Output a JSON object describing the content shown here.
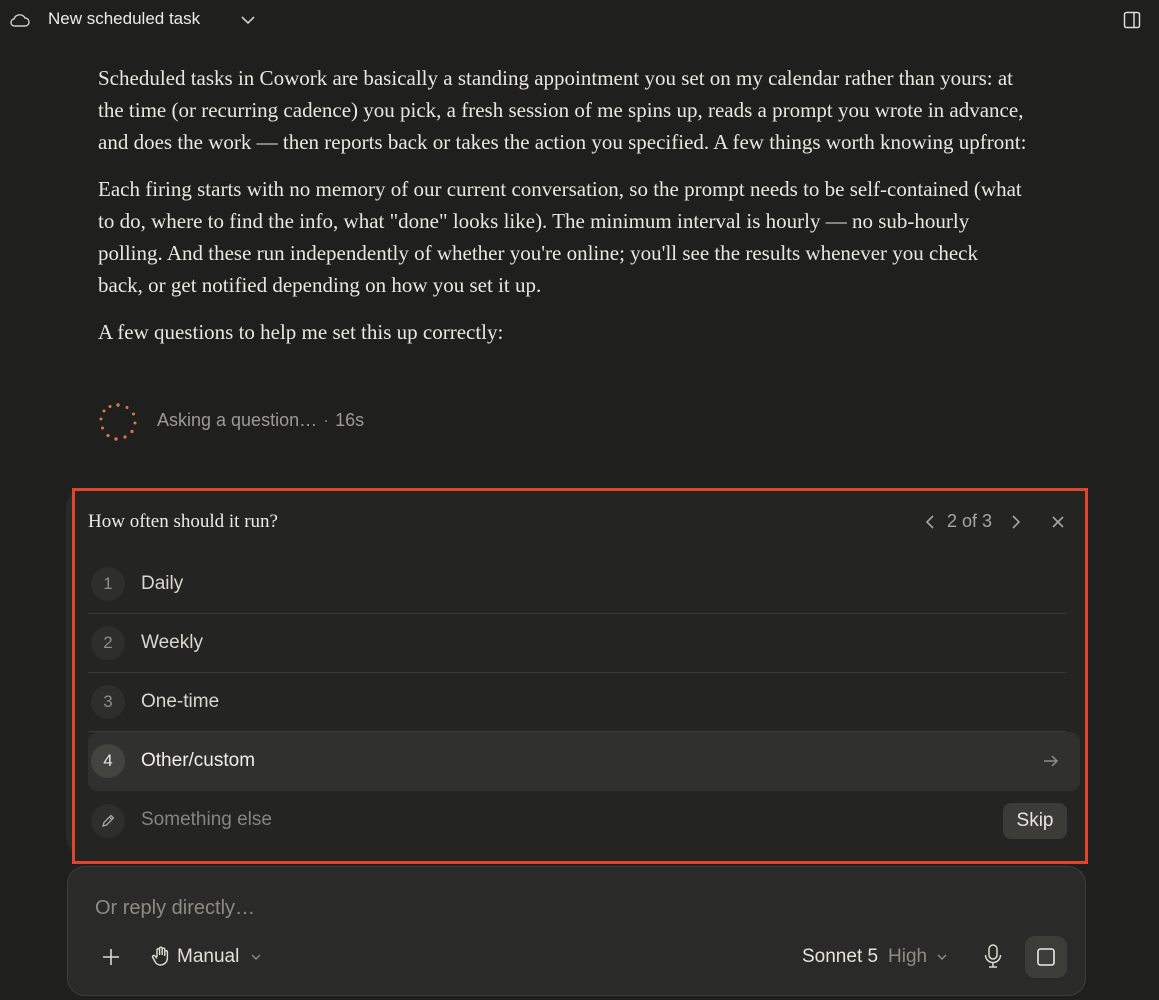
{
  "header": {
    "title": "New scheduled task"
  },
  "message": {
    "paragraphs": [
      "Scheduled tasks in Cowork are basically a standing appointment you set on my calendar rather than yours: at the time (or recurring cadence) you pick, a fresh session of me spins up, reads a prompt you wrote in advance, and does the work — then reports back or takes the action you specified. A few things worth knowing upfront:",
      "Each firing starts with no memory of our current conversation, so the prompt needs to be self-contained (what to do, where to find the info, what \"done\" looks like). The minimum interval is hourly — no sub-hourly polling. And these run independently of whether you're online; you'll see the results whenever you check back, or get notified depending on how you set it up.",
      "A few questions to help me set this up correctly:"
    ]
  },
  "status": {
    "text": "Asking a question…",
    "separator": "·",
    "elapsed": "16s"
  },
  "question": {
    "title": "How often should it run?",
    "pager": "2 of 3",
    "options": [
      {
        "num": "1",
        "label": "Daily"
      },
      {
        "num": "2",
        "label": "Weekly"
      },
      {
        "num": "3",
        "label": "One-time"
      },
      {
        "num": "4",
        "label": "Other/custom"
      }
    ],
    "other_placeholder": "Something else",
    "skip_label": "Skip"
  },
  "composer": {
    "placeholder": "Or reply directly…",
    "mode_label": "Manual",
    "model_name": "Sonnet 5",
    "model_effort": "High"
  },
  "colors": {
    "background": "#1f1f1e",
    "highlight_border": "#e0442d",
    "spinner": "#d9774b"
  },
  "icons": [
    "cloud-icon",
    "chevron-down-icon",
    "sidebar-panel-icon",
    "spinner-icon",
    "chevron-left-icon",
    "chevron-right-icon",
    "close-icon",
    "arrow-right-icon",
    "pencil-icon",
    "plus-icon",
    "hand-icon",
    "microphone-icon",
    "stop-icon"
  ]
}
